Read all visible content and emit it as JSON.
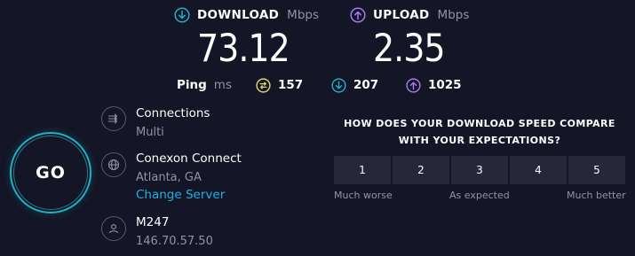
{
  "download": {
    "label": "DOWNLOAD",
    "unit": "Mbps",
    "value": "73.12",
    "icon": "arrow-down-circle-icon",
    "color": "#1fb1c4"
  },
  "upload": {
    "label": "UPLOAD",
    "unit": "Mbps",
    "value": "2.35",
    "icon": "arrow-up-circle-icon",
    "color": "#a77bf3"
  },
  "ping": {
    "label": "Ping",
    "unit": "ms",
    "idle": {
      "value": "157",
      "icon": "ping-icon",
      "color": "#e2d76b"
    },
    "download": {
      "value": "207",
      "icon": "arrow-down-circle-icon",
      "color": "#1fb1c4"
    },
    "upload": {
      "value": "1025",
      "icon": "arrow-up-circle-icon",
      "color": "#a77bf3"
    }
  },
  "go_button": {
    "label": "GO",
    "color": "#1fb1c4"
  },
  "connections": {
    "title": "Connections",
    "mode": "Multi",
    "icon": "connections-icon"
  },
  "server": {
    "name": "Conexon Connect",
    "location": "Atlanta, GA",
    "change_link": "Change Server",
    "icon": "globe-icon"
  },
  "host": {
    "provider": "M247",
    "ip": "146.70.57.50",
    "icon": "user-icon"
  },
  "survey": {
    "question_line1": "HOW DOES YOUR DOWNLOAD SPEED COMPARE",
    "question_line2": "WITH YOUR EXPECTATIONS?",
    "options": [
      "1",
      "2",
      "3",
      "4",
      "5"
    ],
    "low_label": "Much worse",
    "mid_label": "As expected",
    "high_label": "Much better"
  }
}
